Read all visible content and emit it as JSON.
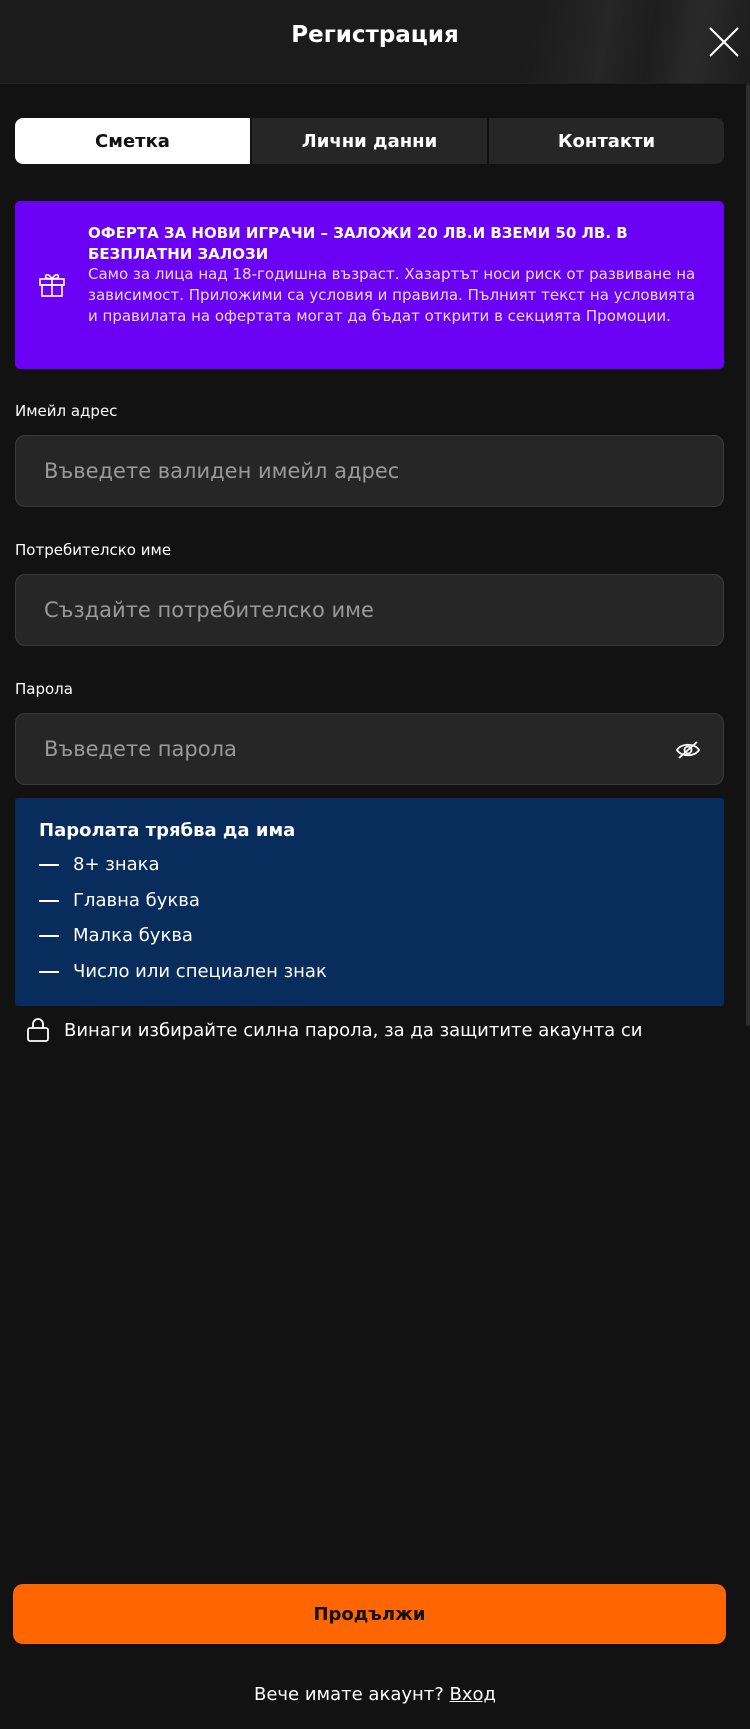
{
  "header": {
    "title": "Регистрация"
  },
  "tabs": [
    {
      "label": "Сметка",
      "active": true
    },
    {
      "label": "Лични данни",
      "active": false
    },
    {
      "label": "Контакти",
      "active": false
    }
  ],
  "promo": {
    "icon": "gift-icon",
    "title": "ОФЕРТА ЗА НОВИ ИГРАЧИ – ЗАЛОЖИ 20 ЛВ.И ВЗЕМИ 50 ЛВ. В БЕЗПЛАТНИ ЗАЛОЗИ",
    "text": "Само за лица над 18-годишна възраст. Хазартът носи риск от развиване на зависимост. Приложими са условия и правила. Пълният текст на условията и правилата на офертата могат да бъдат открити в секцията Промоции.",
    "background": "#6a00f4"
  },
  "form": {
    "email": {
      "label": "Имейл адрес",
      "placeholder": "Въведете валиден имейл адрес"
    },
    "username": {
      "label": "Потребителско име",
      "placeholder": "Създайте потребителско име"
    },
    "password": {
      "label": "Парола",
      "placeholder": "Въведете парола",
      "toggle_icon": "eye-off-icon"
    }
  },
  "requirements": {
    "title": "Паролата трябва да има",
    "items": [
      "8+ знака",
      "Главна буква",
      "Малка буква",
      "Число или специален знак"
    ],
    "background": "#082c5c"
  },
  "hint": {
    "icon": "lock-icon",
    "text": "Винаги избирайте силна парола, за да защитите акаунта си"
  },
  "footer": {
    "continue_label": "Продължи",
    "continue_color": "#ff6600",
    "have_account_text": "Вече имате акаунт?",
    "login_link": "Вход"
  }
}
